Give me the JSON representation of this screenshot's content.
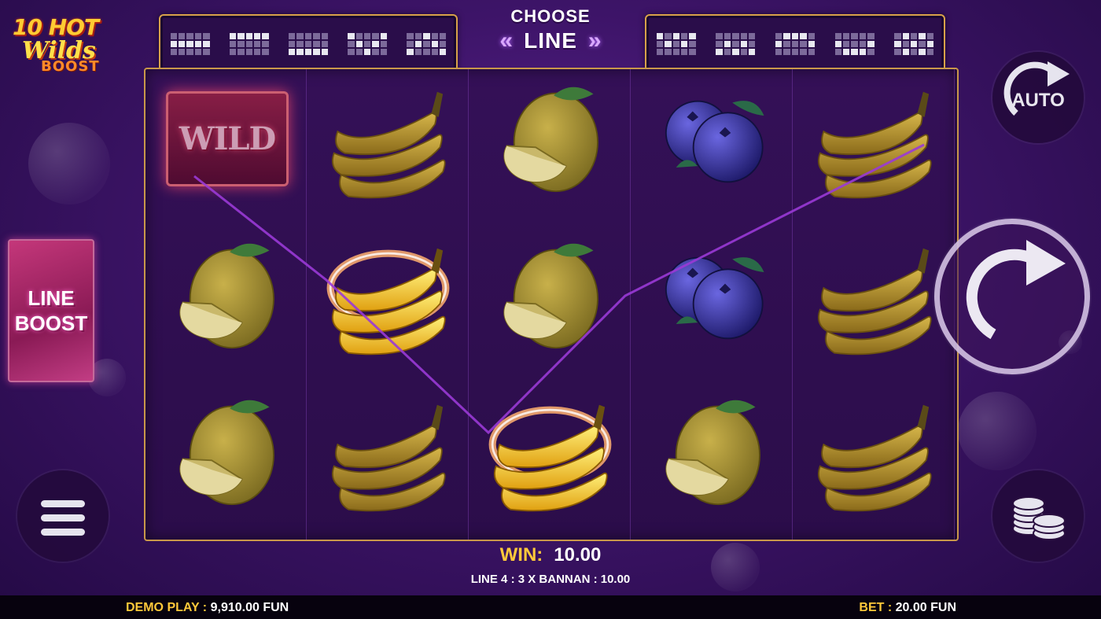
{
  "game": {
    "logo_line1": "10 HOT",
    "logo_line2": "Wilds",
    "logo_line3": "BOOST"
  },
  "line_selector": {
    "title": "CHOOSE",
    "label": "LINE",
    "prev_arrow": "«",
    "next_arrow": "»"
  },
  "line_boost": {
    "line1": "LINE",
    "line2": "BOOST"
  },
  "reels": [
    [
      "wild",
      "lemon",
      "lemon"
    ],
    [
      "banana",
      "banana-highlight",
      "banana"
    ],
    [
      "lemon",
      "lemon",
      "banana-highlight"
    ],
    [
      "blueberry",
      "blueberry",
      "lemon"
    ],
    [
      "banana",
      "banana",
      "banana"
    ]
  ],
  "wild_label": "WILD",
  "buttons": {
    "auto_label": "AUTO",
    "spin": "spin-icon",
    "menu": "menu-icon",
    "coins": "coins-icon"
  },
  "win": {
    "label": "WIN:",
    "value": "10.00",
    "detail": "LINE 4 : 3 X BANNAN : 10.00"
  },
  "footer": {
    "balance_label": "DEMO PLAY :",
    "balance_value": "9,910.00 FUN",
    "bet_label": "BET :",
    "bet_value": "20.00 FUN"
  },
  "colors": {
    "accent_gold": "#ffc93a",
    "frame_gold": "#c9984a",
    "payline": "#9a3ad6",
    "background": "#3d1468"
  }
}
